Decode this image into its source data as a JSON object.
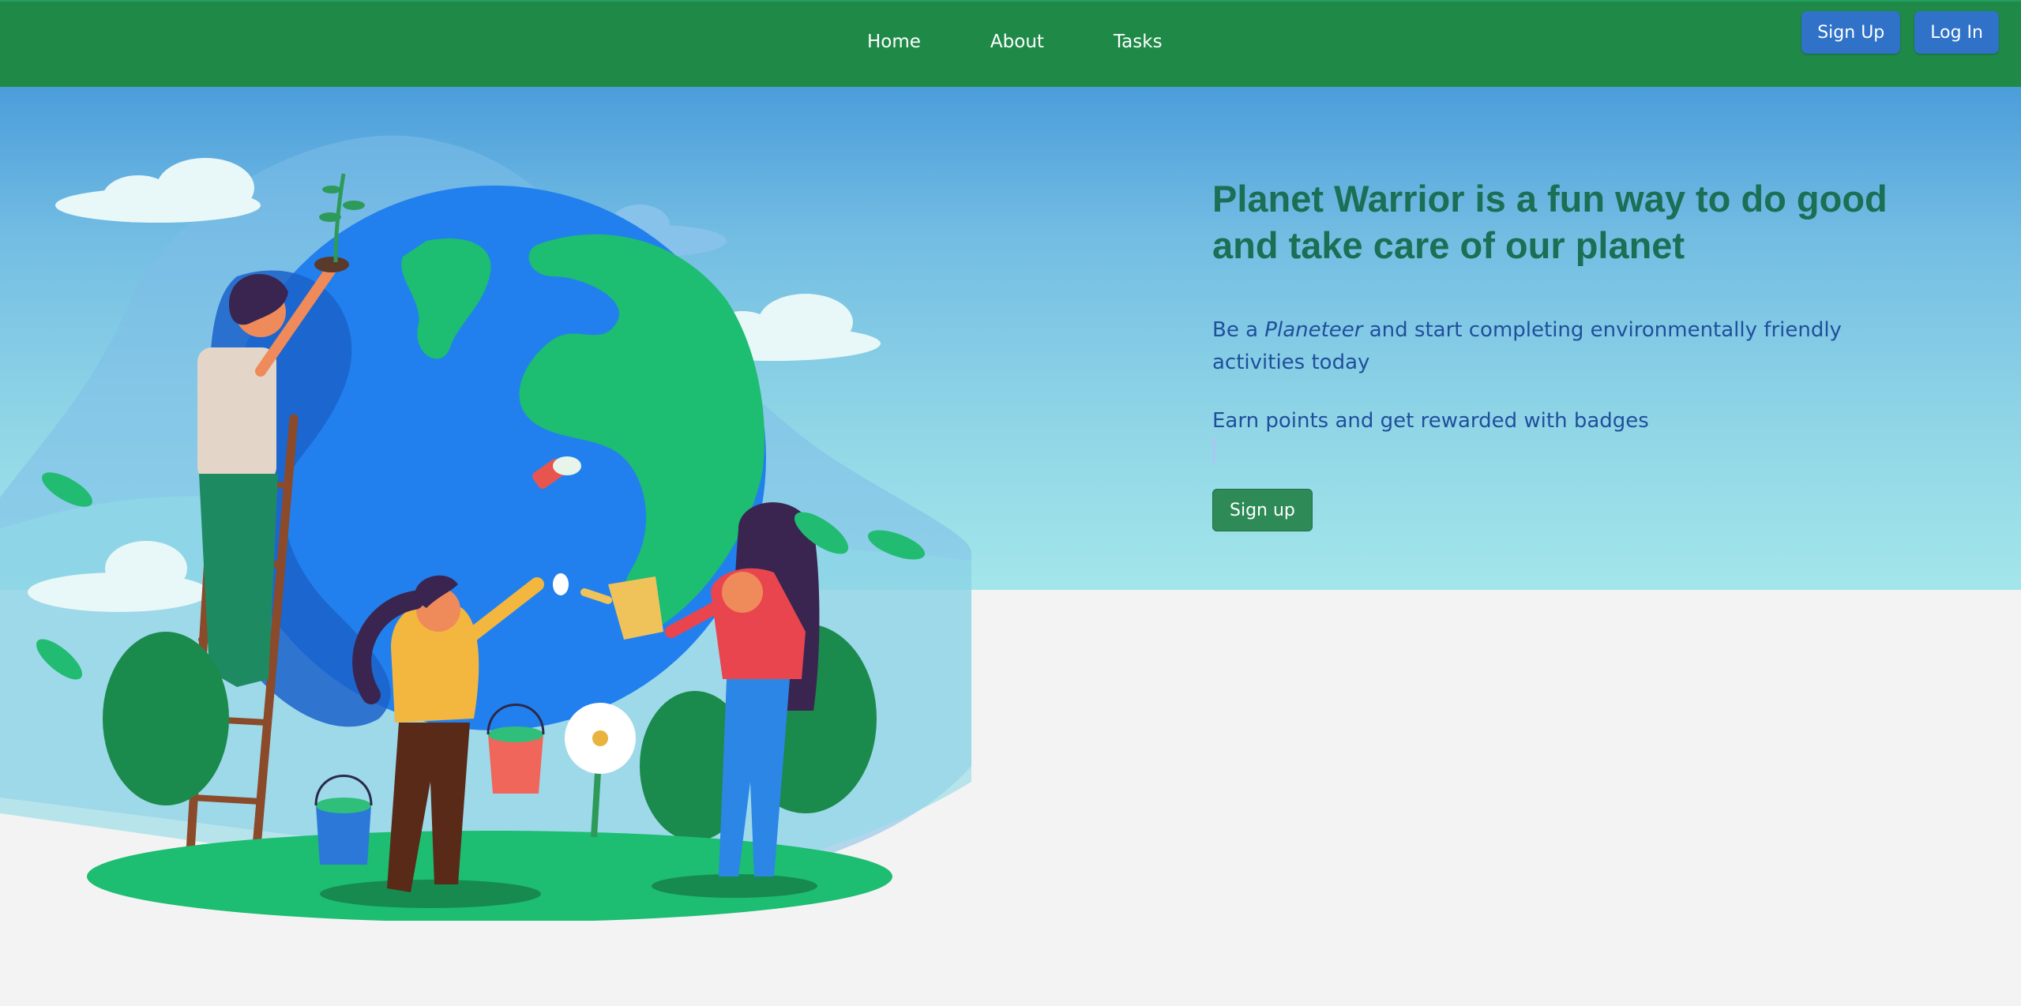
{
  "nav": {
    "links": [
      "Home",
      "About",
      "Tasks"
    ],
    "signup_label": "Sign Up",
    "login_label": "Log In"
  },
  "hero": {
    "headline": "Planet Warrior is a fun way to do good and take care of our planet",
    "intro_prefix": "Be a ",
    "intro_emphasis": "Planeteer",
    "intro_suffix": " and start completing environmentally friendly activities today",
    "rewards_text": "Earn points and get rewarded with badges",
    "cta_label": "Sign up"
  },
  "illustration": {
    "icon": "planet-care-illustration"
  },
  "colors": {
    "navbar": "#1f8a48",
    "auth_button": "#2f72c8",
    "cta_button": "#2e8b57",
    "headline": "#1a6f55",
    "body_text": "#1f4f9c",
    "page_background": "#f3f3f3"
  }
}
